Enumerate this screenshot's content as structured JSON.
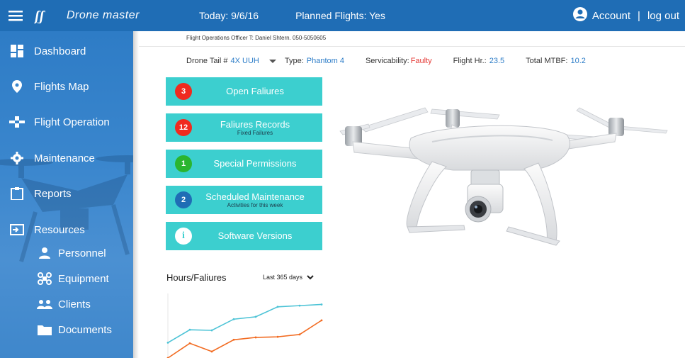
{
  "header": {
    "brand": "Drone master",
    "today": "Today: 9/6/16",
    "planned_flights": "Planned Flights:  Yes",
    "account": "Account",
    "separator": "|",
    "logout": "log out"
  },
  "sidebar": {
    "items": [
      {
        "label": "Dashboard",
        "icon": "dashboard-icon"
      },
      {
        "label": "Flights Map",
        "icon": "map-pin-icon"
      },
      {
        "label": "Flight Operation",
        "icon": "drone-icon"
      },
      {
        "label": "Maintenance",
        "icon": "gear-icon"
      },
      {
        "label": "Reports",
        "icon": "clipboard-icon"
      },
      {
        "label": "Resources",
        "icon": "resources-icon"
      }
    ],
    "sub_items": [
      {
        "label": "Personnel",
        "icon": "person-icon"
      },
      {
        "label": "Equipment",
        "icon": "equipment-icon"
      },
      {
        "label": "Clients",
        "icon": "clients-icon"
      },
      {
        "label": "Documents",
        "icon": "folder-icon"
      }
    ]
  },
  "officer": "Flight Operations Officer T: Daniel Shtern. 050-5050605",
  "drone_info": {
    "tail_label": "Drone Tail #",
    "tail_value": "4X UUH",
    "type_label": "Type:",
    "type_value": "Phantom 4",
    "serviceability_label": "Servicability:",
    "serviceability_value": "Faulty",
    "flight_hr_label": "Flight Hr.:",
    "flight_hr_value": "23.5",
    "mtbf_label": "Total MTBF:",
    "mtbf_value": "10.2"
  },
  "tiles": [
    {
      "badge": "3",
      "label": "Open Faliures",
      "sub": "",
      "badge_color": "#f02a1f"
    },
    {
      "badge": "12",
      "label": "Faliures Records",
      "sub": "Fixed Failures",
      "badge_color": "#f02a1f"
    },
    {
      "badge": "1",
      "label": "Special Permissions",
      "sub": "",
      "badge_color": "#2ab52f"
    },
    {
      "badge": "2",
      "label": "Scheduled Maintenance",
      "sub": "Activities for this week",
      "badge_color": "#1f6db5"
    },
    {
      "badge": "i",
      "label": "Software Versions",
      "sub": "",
      "badge_color": "#3ccfcf"
    }
  ],
  "chart": {
    "title": "Hours/Faliures",
    "range": "Last 365 days"
  },
  "chart_data": {
    "type": "line",
    "title": "Hours/Faliures",
    "xlabel": "",
    "ylabel": "",
    "ylim": [
      0,
      100
    ],
    "grid": false,
    "series": [
      {
        "color": "#4cc3d6",
        "values": [
          26,
          48,
          47,
          66,
          70,
          87,
          89,
          91
        ]
      },
      {
        "color": "#f26b21",
        "values": [
          0,
          25,
          11,
          31,
          35,
          36,
          40,
          64
        ]
      }
    ]
  },
  "colors": {
    "topbar": "#1f6db5",
    "sidebar": "#3a86cd",
    "tile": "#3ccfcf",
    "accent_blue": "#2d7dc8",
    "status_red": "#e53935"
  }
}
